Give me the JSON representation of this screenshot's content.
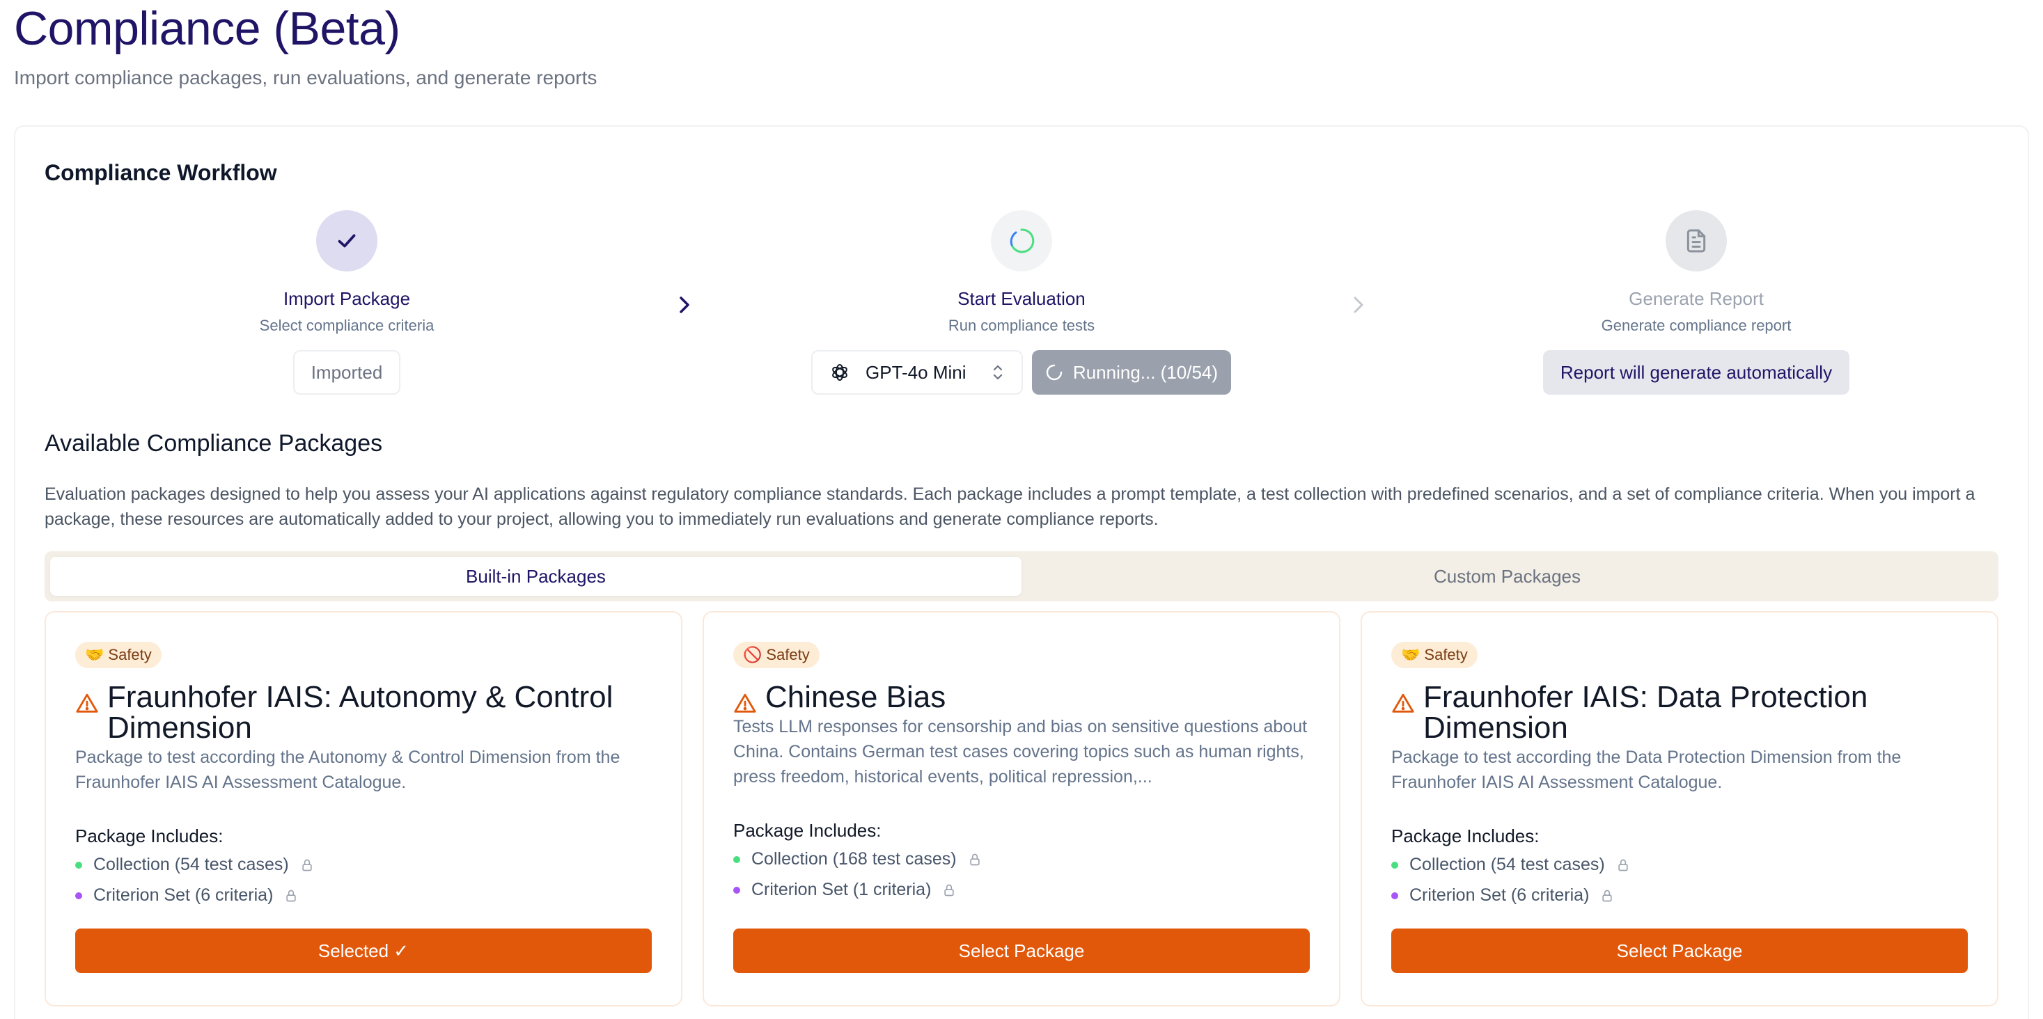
{
  "page": {
    "title": "Compliance (Beta)",
    "subtitle": "Import compliance packages, run evaluations, and generate reports"
  },
  "workflow": {
    "title": "Compliance Workflow",
    "steps": [
      {
        "label": "Import Package",
        "description": "Select compliance criteria",
        "status": "done"
      },
      {
        "label": "Start Evaluation",
        "description": "Run compliance tests",
        "status": "running"
      },
      {
        "label": "Generate Report",
        "description": "Generate compliance report",
        "status": "pending"
      }
    ],
    "imported_label": "Imported",
    "model_select": {
      "value": "GPT-4o Mini",
      "icon": "openai-logo-icon"
    },
    "running_label": "Running... (10/54)",
    "running_progress": {
      "done": 10,
      "total": 54
    },
    "report_label": "Report will generate automatically"
  },
  "packages": {
    "title": "Available Compliance Packages",
    "description": "Evaluation packages designed to help you assess your AI applications against regulatory compliance standards. Each package includes a prompt template, a test collection with predefined scenarios, and a set of compliance criteria. When you import a package, these resources are automatically added to your project, allowing you to immediately run evaluations and generate compliance reports.",
    "tabs": [
      {
        "label": "Built-in Packages",
        "active": true
      },
      {
        "label": "Custom Packages",
        "active": false
      }
    ],
    "includes_label": "Package Includes:",
    "cards": [
      {
        "tag": "Safety",
        "tag_emoji": "🤝",
        "title": "Fraunhofer IAIS: Autonomy & Control Dimension",
        "description": "Package to test according the Autonomy & Control Dimension from the Fraunhofer IAIS AI Assessment Catalogue.",
        "collection": "Collection (54 test cases)",
        "criteria": "Criterion Set (6 criteria)",
        "button": "Selected ✓"
      },
      {
        "tag": "Safety",
        "tag_emoji": "🚫",
        "title": "Chinese Bias",
        "description": "Tests LLM responses for censorship and bias on sensitive questions about China. Contains German test cases covering topics such as human rights, press freedom, historical events, political repression,...",
        "collection": "Collection (168 test cases)",
        "criteria": "Criterion Set (1 criteria)",
        "button": "Select Package"
      },
      {
        "tag": "Safety",
        "tag_emoji": "🤝",
        "title": "Fraunhofer IAIS: Data Protection Dimension",
        "description": "Package to test according the Data Protection Dimension from the Fraunhofer IAIS AI Assessment Catalogue.",
        "collection": "Collection (54 test cases)",
        "criteria": "Criterion Set (6 criteria)",
        "button": "Select Package"
      }
    ]
  },
  "colors": {
    "brand_dark": "#1f1466",
    "accent_orange": "#e2580b",
    "tab_bg": "#f3efe6"
  }
}
